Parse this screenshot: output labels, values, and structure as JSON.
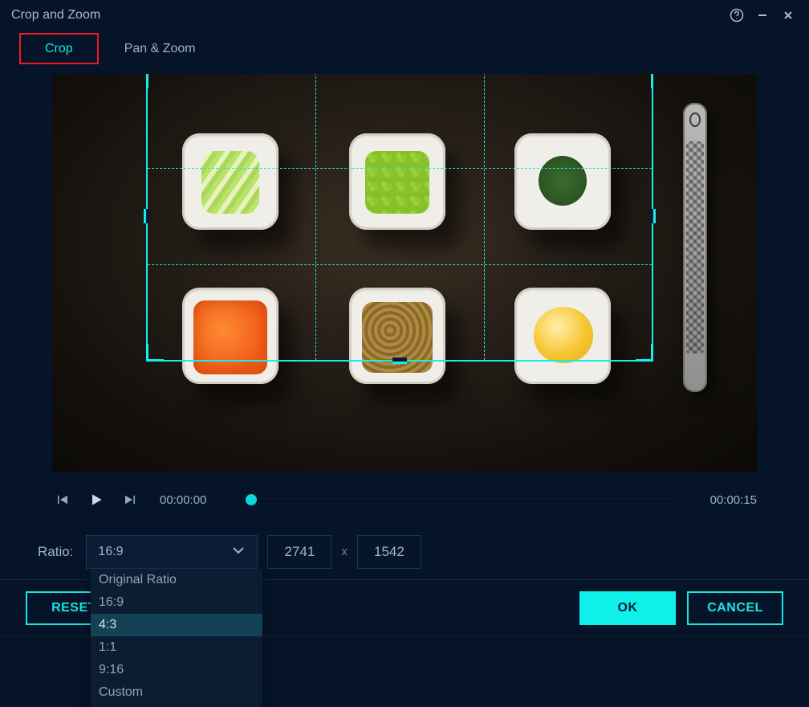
{
  "title": "Crop and Zoom",
  "tabs": {
    "crop": "Crop",
    "panzoom": "Pan & Zoom"
  },
  "transport": {
    "current": "00:00:00",
    "total": "00:00:15"
  },
  "ratio": {
    "label": "Ratio:",
    "selected": "16:9",
    "width": "2741",
    "height": "1542",
    "options": [
      "Original Ratio",
      "16:9",
      "4:3",
      "1:1",
      "9:16",
      "Custom"
    ],
    "highlighted_index": 2
  },
  "buttons": {
    "reset": "RESET",
    "ok": "OK",
    "cancel": "CANCEL"
  }
}
